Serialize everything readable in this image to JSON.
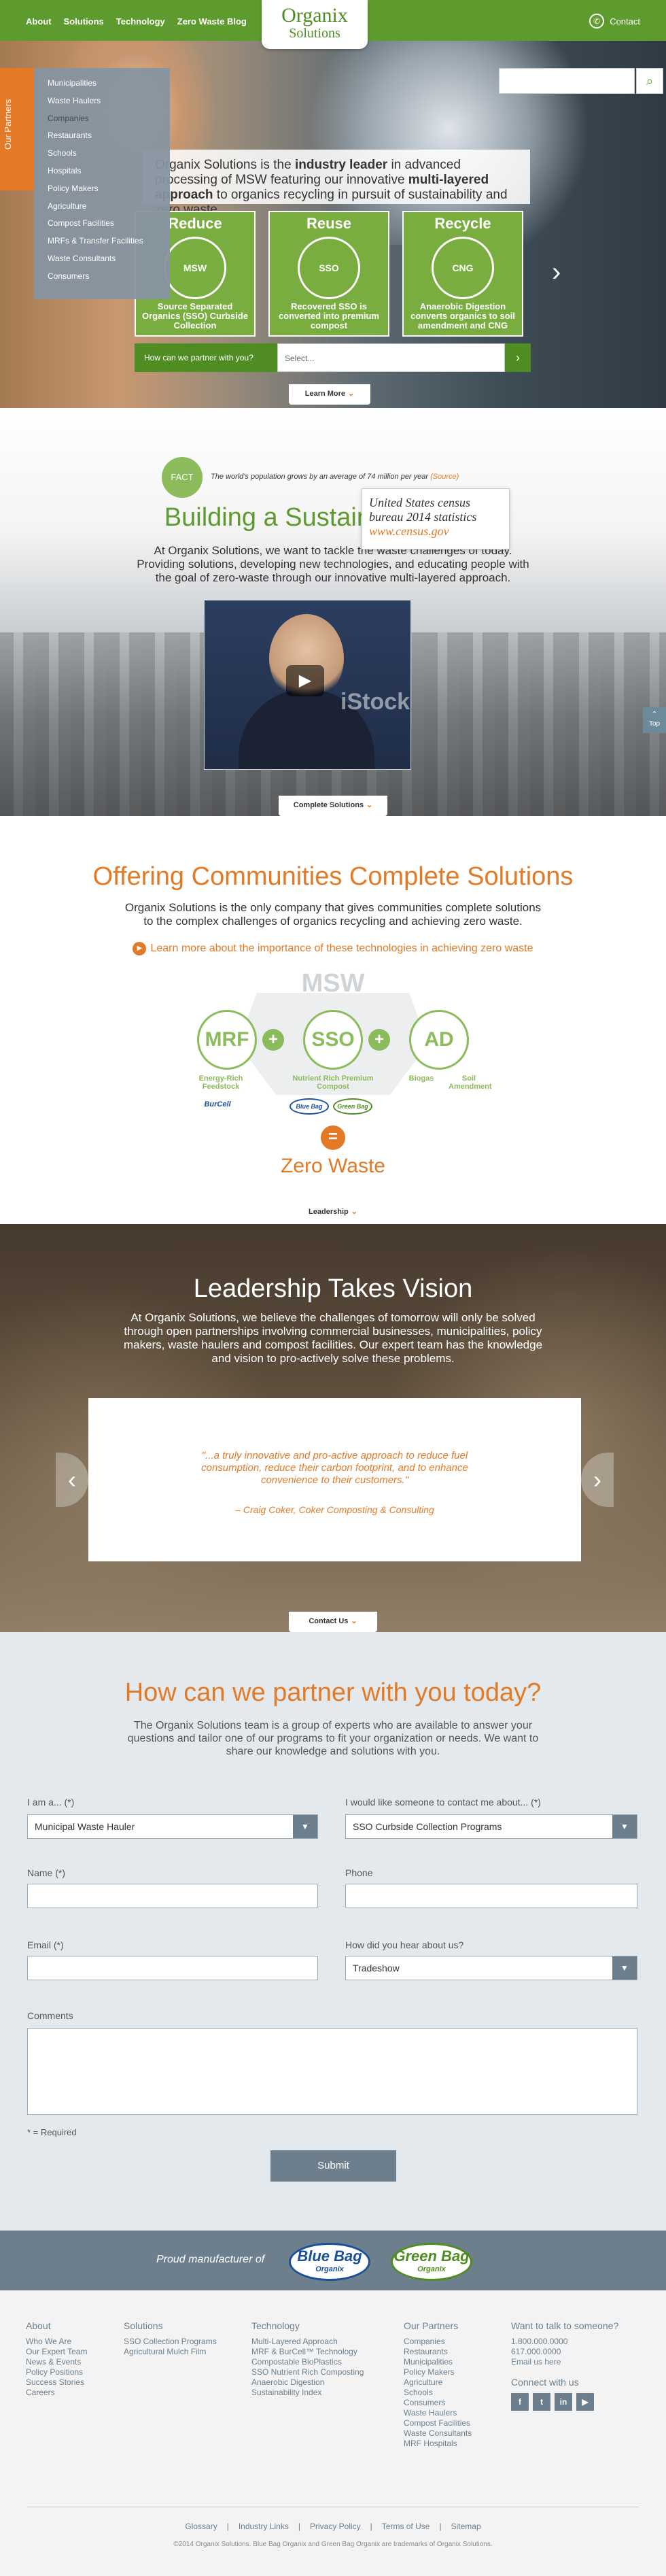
{
  "nav": {
    "links": [
      "About",
      "Solutions",
      "Technology",
      "Zero Waste Blog"
    ],
    "logo_name": "Organix",
    "logo_sub": "Solutions",
    "contact_label": "Contact"
  },
  "hero": {
    "partners_tab": "Our Partners",
    "partners_menu": [
      "Municipalities",
      "Waste Haulers",
      "Companies",
      "Restaurants",
      "Schools",
      "Hospitals",
      "Policy Makers",
      "Agriculture",
      "Compost Facilities",
      "MRFs & Transfer Facilities",
      "Waste Consultants",
      "Consumers"
    ],
    "intro_prefix": "Organix Solutions is the ",
    "intro_bold1": "industry leader",
    "intro_mid": " in advanced processing of MSW featuring our innovative ",
    "intro_bold2": "multi-layered approach",
    "intro_suffix": " to organics recycling in pursuit of sustainability and zero waste.",
    "cards": [
      {
        "title": "Reduce",
        "icon": "MSW",
        "desc": "Source Separated Organics (SSO) Curbside Collection"
      },
      {
        "title": "Reuse",
        "icon": "SSO",
        "desc": "Recovered SSO is converted into premium compost"
      },
      {
        "title": "Recycle",
        "icon": "CNG",
        "desc": "Anaerobic Digestion converts organics to soil amendment and CNG"
      }
    ],
    "partner_question": "How can we partner with you?",
    "partner_select": "Select...",
    "learn_more": "Learn More"
  },
  "fact": {
    "badge": "FACT",
    "text": "The world's population grows by an average of 74 million per year",
    "source": "(Source)",
    "tooltip_line1": "United States census",
    "tooltip_line2": "bureau 2014 statistics",
    "tooltip_url": "www.census.gov",
    "title": "Building a Sustainable Future",
    "body": "At Organix Solutions, we want to tackle the waste challenges of today. Providing solutions, developing new technologies, and educating people with the goal of zero-waste through our innovative multi-layered approach.",
    "watermark": "iStock",
    "next_tab": "Complete Solutions",
    "top_label": "Top"
  },
  "solutions": {
    "title": "Offering Communities Complete Solutions",
    "body": "Organix Solutions is the only company that gives communities complete solutions to the complex challenges of organics recycling and achieving zero waste.",
    "link": "Learn more about the importance of these technologies in achieving zero waste",
    "msw": "MSW",
    "nodes": [
      "MRF",
      "SSO",
      "AD"
    ],
    "labels": {
      "mrf": "Energy-Rich Feedstock",
      "sso": "Nutrient Rich Premium Compost",
      "biogas": "Biogas",
      "soil": "Soil Amendment"
    },
    "burcell": "BurCell",
    "bluebag": "Blue Bag",
    "greenbag": "Green Bag",
    "zero": "Zero Waste",
    "next_tab": "Leadership"
  },
  "leadership": {
    "title": "Leadership Takes Vision",
    "body": "At Organix Solutions, we believe the challenges of tomorrow will only be solved through open partnerships involving commercial businesses, municipalities, policy makers, waste haulers and compost facilities. Our expert team has the knowledge and vision to pro-actively solve these problems.",
    "quote": "\"...a truly innovative and pro-active approach to reduce fuel consumption, reduce their carbon footprint, and to enhance convenience to their customers.\"",
    "author": "– Craig Coker, Coker Composting & Consulting",
    "next_tab": "Contact Us"
  },
  "form": {
    "title": "How can we partner with you today?",
    "body": "The Organix Solutions team is a group of experts who are available to answer your questions and tailor one of our programs to fit your organization or needs. We want to share our knowledge and solutions with you.",
    "iam_label": "I am a... (*)",
    "iam_value": "Municipal Waste Hauler",
    "contact_label": "I would like someone to contact me about... (*)",
    "contact_value": "SSO Curbside Collection Programs",
    "name_label": "Name (*)",
    "phone_label": "Phone",
    "email_label": "Email (*)",
    "hear_label": "How did you hear about us?",
    "hear_value": "Tradeshow",
    "comments_label": "Comments",
    "required_note": "* = Required",
    "submit": "Submit"
  },
  "brand": {
    "text": "Proud manufacturer of",
    "blue": "Blue Bag",
    "green": "Green Bag",
    "organix": "Organix"
  },
  "footer": {
    "about": {
      "title": "About",
      "items": [
        "Who We Are",
        "Our Expert Team",
        "News & Events",
        "Policy Positions",
        "Success Stories",
        "Careers"
      ]
    },
    "solutions": {
      "title": "Solutions",
      "items": [
        "SSO Collection Programs",
        "Agricultural Mulch Film"
      ]
    },
    "technology": {
      "title": "Technology",
      "items": [
        "Multi-Layered Approach",
        "MRF & BurCell™ Technology",
        "Compostable BioPlastics",
        "SSO Nutrient Rich Composting",
        "Anaerobic Digestion",
        "Sustainability Index"
      ]
    },
    "partners": {
      "title": "Our Partners",
      "items": [
        "Companies",
        "Restaurants",
        "Municipalities",
        "Policy Makers",
        "Agriculture",
        "Schools",
        "Consumers",
        "Waste Haulers",
        "Compost Facilities",
        "Waste Consultants",
        "MRF Hospitals"
      ]
    },
    "talk": {
      "title": "Want to talk to someone?",
      "items": [
        "1.800.000.0000",
        "617.000.0000",
        "Email us here"
      ]
    },
    "connect": "Connect with us",
    "social": [
      "f",
      "t",
      "in",
      "▶"
    ],
    "links": [
      "Glossary",
      "Industry Links",
      "Privacy Policy",
      "Terms of Use",
      "Sitemap"
    ],
    "copyright": "©2014 Organix Solutions.  Blue Bag Organix and Green Bag Organix are trademarks of Organix Solutions."
  }
}
